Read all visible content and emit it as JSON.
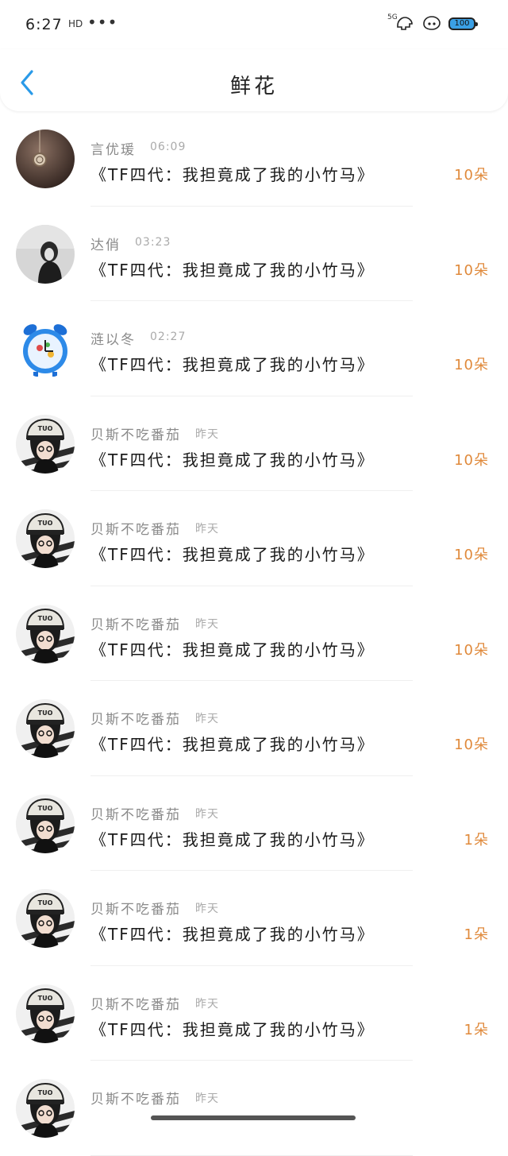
{
  "status_bar": {
    "time": "6:27",
    "sim_label": "HD",
    "more_dots": "•••",
    "network": "5G",
    "battery": "100"
  },
  "header": {
    "title": "鲜花"
  },
  "colors": {
    "accent_back": "#2a9ae8",
    "amount_orange": "#e08a3c"
  },
  "rows": [
    {
      "name": "言优瑗",
      "time": "06:09",
      "book": "《TF四代：我担竟成了我的小竹马》",
      "amount": "10朵",
      "avatar": "pocket-watch-avatar"
    },
    {
      "name": "达俏",
      "time": "03:23",
      "book": "《TF四代：我担竟成了我的小竹马》",
      "amount": "10朵",
      "avatar": "girl-grayscale-avatar"
    },
    {
      "name": "涟以冬",
      "time": "02:27",
      "book": "《TF四代：我担竟成了我的小竹马》",
      "amount": "10朵",
      "avatar": "alarm-clock-avatar"
    },
    {
      "name": "贝斯不吃番茄",
      "time": "昨天",
      "book": "《TF四代：我担竟成了我的小竹马》",
      "amount": "10朵",
      "avatar": "boy-cap-avatar"
    },
    {
      "name": "贝斯不吃番茄",
      "time": "昨天",
      "book": "《TF四代：我担竟成了我的小竹马》",
      "amount": "10朵",
      "avatar": "boy-cap-avatar"
    },
    {
      "name": "贝斯不吃番茄",
      "time": "昨天",
      "book": "《TF四代：我担竟成了我的小竹马》",
      "amount": "10朵",
      "avatar": "boy-cap-avatar"
    },
    {
      "name": "贝斯不吃番茄",
      "time": "昨天",
      "book": "《TF四代：我担竟成了我的小竹马》",
      "amount": "10朵",
      "avatar": "boy-cap-avatar"
    },
    {
      "name": "贝斯不吃番茄",
      "time": "昨天",
      "book": "《TF四代：我担竟成了我的小竹马》",
      "amount": "1朵",
      "avatar": "boy-cap-avatar"
    },
    {
      "name": "贝斯不吃番茄",
      "time": "昨天",
      "book": "《TF四代：我担竟成了我的小竹马》",
      "amount": "1朵",
      "avatar": "boy-cap-avatar"
    },
    {
      "name": "贝斯不吃番茄",
      "time": "昨天",
      "book": "《TF四代：我担竟成了我的小竹马》",
      "amount": "1朵",
      "avatar": "boy-cap-avatar"
    },
    {
      "name": "贝斯不吃番茄",
      "time": "昨天",
      "book": "",
      "amount": "",
      "avatar": "boy-cap-avatar"
    }
  ]
}
